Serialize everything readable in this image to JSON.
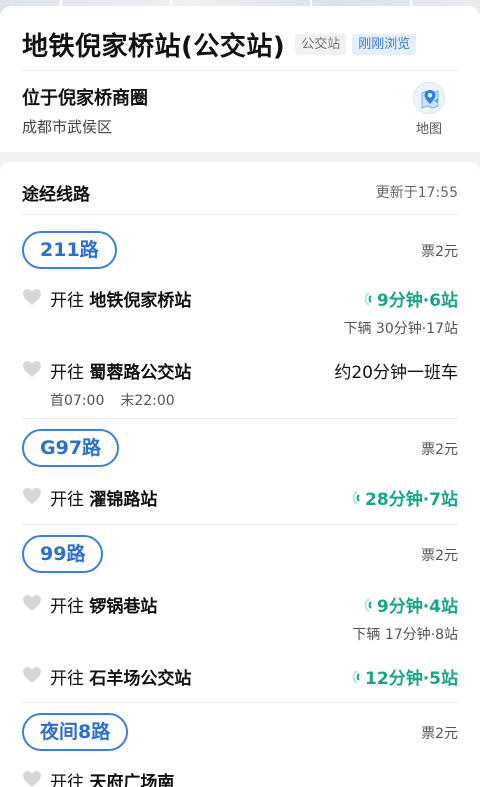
{
  "header": {
    "title": "地铁倪家桥站(公交站)",
    "type_tag": "公交站",
    "recent_tag": "刚刚浏览",
    "location_title": "位于倪家桥商圈",
    "location_sub": "成都市武侯区",
    "map_label": "地图"
  },
  "section": {
    "title": "途经线路",
    "updated": "更新于17:55"
  },
  "routes": [
    {
      "name": "211路",
      "fare": "票2元",
      "directions": [
        {
          "prefix": "开往",
          "dest": "地铁倪家桥站",
          "eta": "9分钟·6站",
          "next": "下辆 30分钟·17站"
        },
        {
          "prefix": "开往",
          "dest": "蜀蓉路公交站",
          "eta": "约20分钟一班车",
          "first": "首07:00",
          "last": "末22:00"
        }
      ]
    },
    {
      "name": "G97路",
      "fare": "票2元",
      "directions": [
        {
          "prefix": "开往",
          "dest": "濯锦路站",
          "eta": "28分钟·7站"
        }
      ]
    },
    {
      "name": "99路",
      "fare": "票2元",
      "directions": [
        {
          "prefix": "开往",
          "dest": "锣锅巷站",
          "eta": "9分钟·4站",
          "next": "下辆 17分钟·8站"
        },
        {
          "prefix": "开往",
          "dest": "石羊场公交站",
          "eta": "12分钟·5站"
        }
      ]
    },
    {
      "name": "夜间8路",
      "fare": "票2元",
      "directions": [
        {
          "prefix": "开往",
          "dest": "天府广场南"
        }
      ]
    }
  ],
  "colors": {
    "accent_blue": "#3d7fd9",
    "eta_green": "#1aa58a"
  },
  "icons": {
    "map": "map-pin-icon",
    "favorite": "heart-icon",
    "realtime": "signal-icon"
  }
}
